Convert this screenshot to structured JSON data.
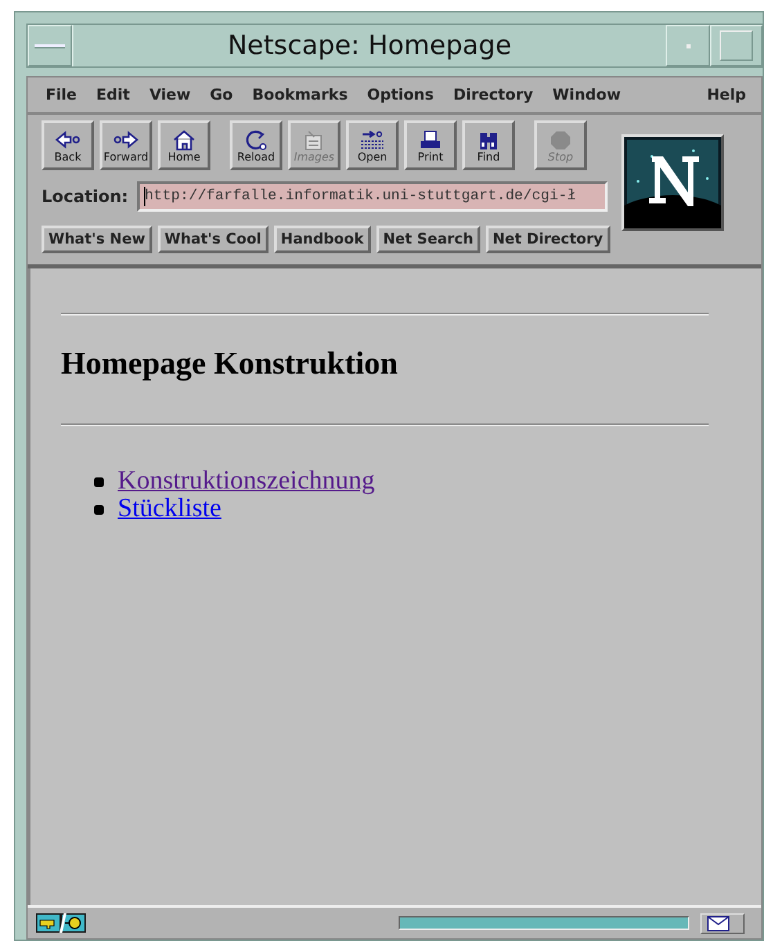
{
  "window": {
    "title": "Netscape: Homepage"
  },
  "menu": [
    "File",
    "Edit",
    "View",
    "Go",
    "Bookmarks",
    "Options",
    "Directory",
    "Window"
  ],
  "help_menu": "Help",
  "toolbar": [
    {
      "label": "Back",
      "disabled": false
    },
    {
      "label": "Forward",
      "disabled": false
    },
    {
      "label": "Home",
      "disabled": false
    },
    {
      "label": "Reload",
      "disabled": false
    },
    {
      "label": "Images",
      "disabled": true
    },
    {
      "label": "Open",
      "disabled": false
    },
    {
      "label": "Print",
      "disabled": false
    },
    {
      "label": "Find",
      "disabled": false
    },
    {
      "label": "Stop",
      "disabled": true
    }
  ],
  "location": {
    "label": "Location:",
    "value": "http://farfalle.informatik.uni-stuttgart.de/cgi-ł"
  },
  "directory_buttons": [
    "What's New",
    "What's Cool",
    "Handbook",
    "Net Search",
    "Net Directory"
  ],
  "page": {
    "heading": "Homepage Konstruktion",
    "links": [
      {
        "text": "Konstruktionszeichnung",
        "visited": true
      },
      {
        "text": "Stückliste",
        "visited": false
      }
    ]
  },
  "status_bar": {
    "progress": {
      "level": 1
    }
  }
}
